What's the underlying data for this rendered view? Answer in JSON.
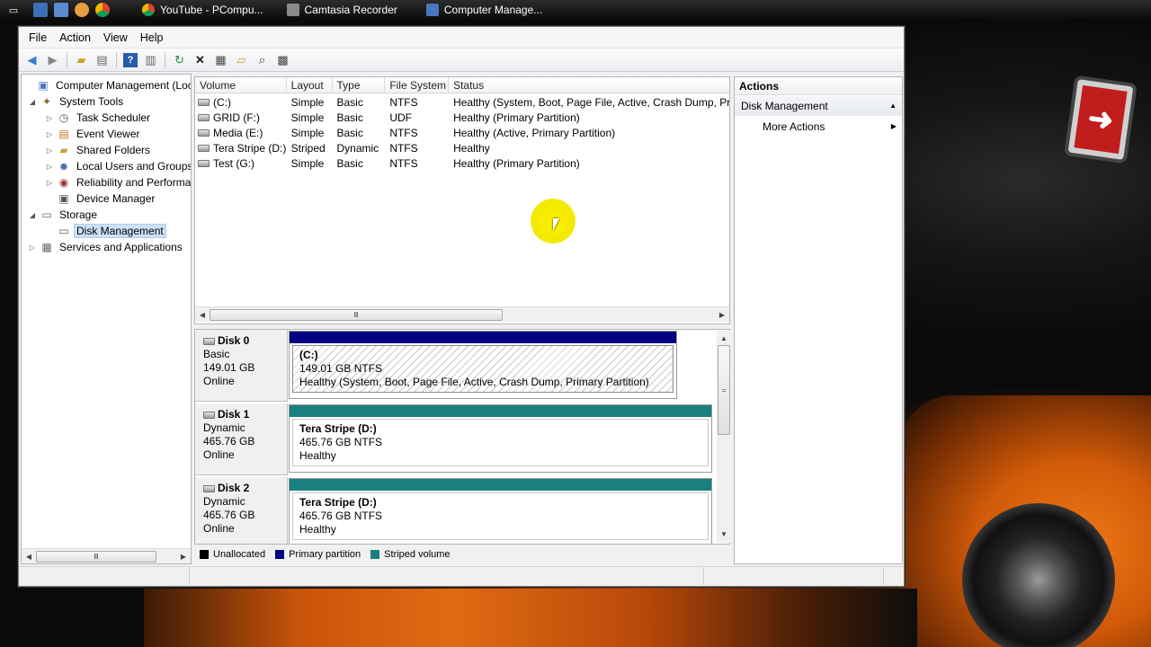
{
  "taskbar": {
    "tasks": [
      {
        "label": "YouTube - PCompu...",
        "icon": "chrome-icon",
        "color": "#e8a317"
      },
      {
        "label": "Camtasia Recorder",
        "icon": "camtasia-icon",
        "color": "#9a9a9a"
      },
      {
        "label": "Computer Manage...",
        "icon": "computer-management-icon",
        "color": "#4a78c0"
      }
    ]
  },
  "menu": {
    "file": "File",
    "action": "Action",
    "view": "View",
    "help": "Help"
  },
  "tree": {
    "root": "Computer Management (Local",
    "system_tools": "System Tools",
    "task_scheduler": "Task Scheduler",
    "event_viewer": "Event Viewer",
    "shared_folders": "Shared Folders",
    "local_users": "Local Users and Groups",
    "reliability": "Reliability and Performa",
    "device_manager": "Device Manager",
    "storage": "Storage",
    "disk_management": "Disk Management",
    "services": "Services and Applications"
  },
  "volumes": {
    "headers": {
      "volume": "Volume",
      "layout": "Layout",
      "type": "Type",
      "fs": "File System",
      "status": "Status"
    },
    "rows": [
      {
        "volume": "(C:)",
        "layout": "Simple",
        "type": "Basic",
        "fs": "NTFS",
        "status": "Healthy (System, Boot, Page File, Active, Crash Dump, Prim"
      },
      {
        "volume": "GRID (F:)",
        "layout": "Simple",
        "type": "Basic",
        "fs": "UDF",
        "status": "Healthy (Primary Partition)"
      },
      {
        "volume": "Media (E:)",
        "layout": "Simple",
        "type": "Basic",
        "fs": "NTFS",
        "status": "Healthy (Active, Primary Partition)"
      },
      {
        "volume": "Tera Stripe (D:)",
        "layout": "Striped",
        "type": "Dynamic",
        "fs": "NTFS",
        "status": "Healthy"
      },
      {
        "volume": "Test (G:)",
        "layout": "Simple",
        "type": "Basic",
        "fs": "NTFS",
        "status": "Healthy (Primary Partition)"
      }
    ]
  },
  "disks": [
    {
      "name": "Disk 0",
      "kind": "Basic",
      "size": "149.01 GB",
      "state": "Online",
      "partition": {
        "name": "(C:)",
        "size": "149.01 GB NTFS",
        "status": "Healthy (System, Boot, Page File, Active, Crash Dump, Primary Partition)",
        "bar_color": "#000080"
      }
    },
    {
      "name": "Disk 1",
      "kind": "Dynamic",
      "size": "465.76 GB",
      "state": "Online",
      "partition": {
        "name": "Tera Stripe  (D:)",
        "size": "465.76 GB NTFS",
        "status": "Healthy",
        "bar_color": "#1a7f7f"
      }
    },
    {
      "name": "Disk 2",
      "kind": "Dynamic",
      "size": "465.76 GB",
      "state": "Online",
      "partition": {
        "name": "Tera Stripe  (D:)",
        "size": "465.76 GB NTFS",
        "status": "Healthy",
        "bar_color": "#1a7f7f"
      }
    }
  ],
  "legend": {
    "unallocated": "Unallocated",
    "primary": "Primary partition",
    "striped": "Striped volume",
    "colors": {
      "unallocated": "#000000",
      "primary": "#000080",
      "striped": "#1a7f7f"
    }
  },
  "actions": {
    "title": "Actions",
    "section": "Disk Management",
    "more": "More Actions"
  }
}
